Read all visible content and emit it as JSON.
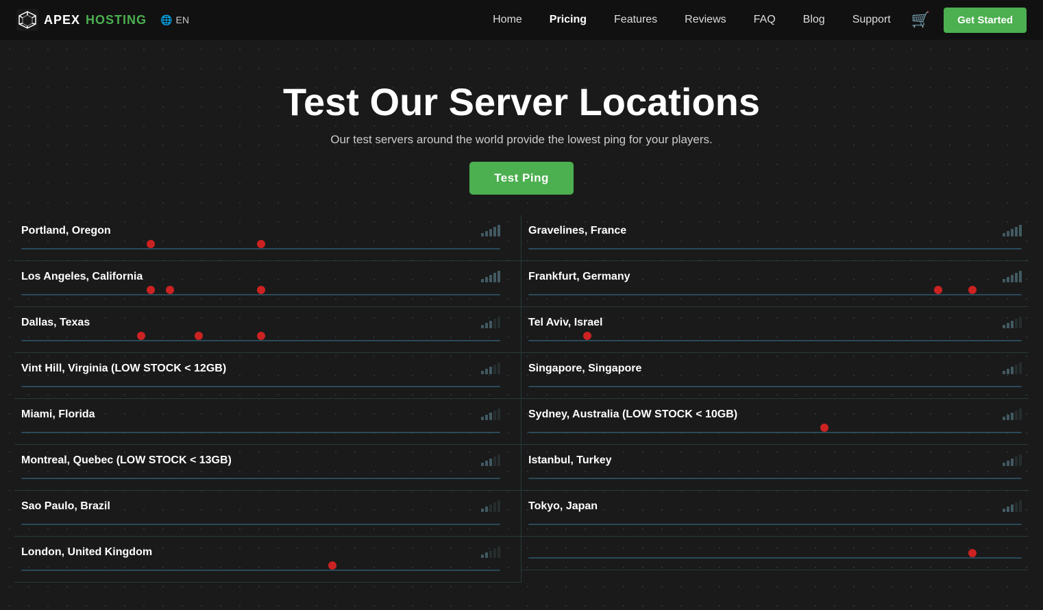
{
  "brand": {
    "name": "APEX",
    "sub": "HOSTING"
  },
  "nav": {
    "lang": "EN",
    "links": [
      {
        "label": "Home",
        "active": false
      },
      {
        "label": "Pricing",
        "active": true
      },
      {
        "label": "Features",
        "active": false
      },
      {
        "label": "Reviews",
        "active": false
      },
      {
        "label": "FAQ",
        "active": false
      },
      {
        "label": "Blog",
        "active": false
      },
      {
        "label": "Support",
        "active": false
      }
    ],
    "cta": "Get Started"
  },
  "hero": {
    "title": "Test Our Server Locations",
    "subtitle": "Our test servers around the world provide the lowest ping for your players.",
    "button": "Test Ping"
  },
  "locations_left": [
    {
      "name": "Portland, Oregon",
      "dots": [
        {
          "pct": 50
        },
        {
          "pct": 27
        }
      ]
    },
    {
      "name": "Los Angeles, California",
      "dots": [
        {
          "pct": 27
        },
        {
          "pct": 30
        },
        {
          "pct": 50
        }
      ]
    },
    {
      "name": "Dallas, Texas",
      "dots": [
        {
          "pct": 25
        },
        {
          "pct": 38
        },
        {
          "pct": 50
        }
      ]
    },
    {
      "name": "Vint Hill, Virginia (LOW STOCK < 12GB)",
      "dots": []
    },
    {
      "name": "Miami, Florida",
      "dots": []
    },
    {
      "name": "Montreal, Quebec (LOW STOCK < 13GB)",
      "dots": []
    },
    {
      "name": "Sao Paulo, Brazil",
      "dots": []
    },
    {
      "name": "London, United Kingdom",
      "dots": [
        {
          "pct": 65
        }
      ]
    }
  ],
  "locations_right": [
    {
      "name": "Gravelines, France",
      "dots": []
    },
    {
      "name": "Frankfurt, Germany",
      "dots": [
        {
          "pct": 83
        },
        {
          "pct": 90
        }
      ]
    },
    {
      "name": "Tel Aviv, Israel",
      "dots": [
        {
          "pct": 12
        }
      ]
    },
    {
      "name": "Singapore, Singapore",
      "dots": []
    },
    {
      "name": "Sydney, Australia (LOW STOCK < 10GB)",
      "dots": [
        {
          "pct": 60
        }
      ]
    },
    {
      "name": "Istanbul, Turkey",
      "dots": []
    },
    {
      "name": "Tokyo, Japan",
      "dots": []
    },
    {
      "name": "",
      "dots": [
        {
          "pct": 90
        }
      ]
    }
  ]
}
